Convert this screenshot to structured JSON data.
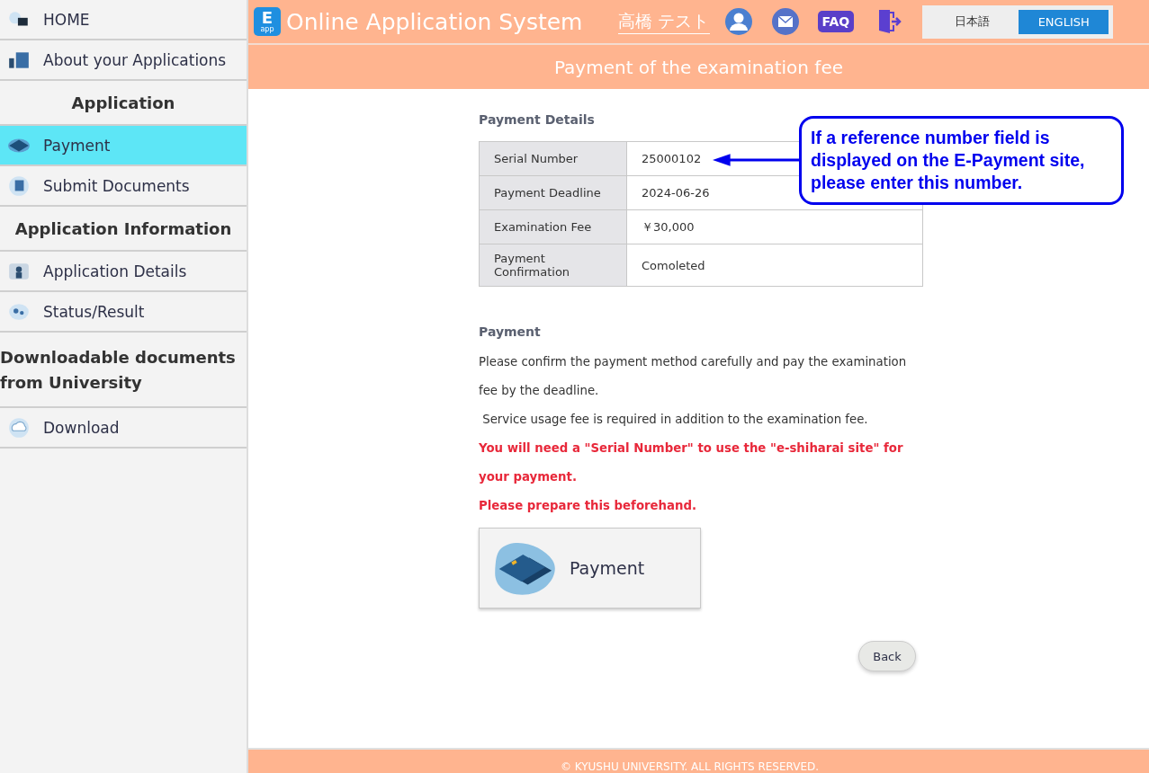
{
  "sidebar": {
    "items": [
      {
        "kind": "link",
        "label": "HOME",
        "selected": false
      },
      {
        "kind": "link",
        "label": "About your Applications",
        "selected": false
      },
      {
        "kind": "heading",
        "label": "Application"
      },
      {
        "kind": "link",
        "label": "Payment",
        "selected": true
      },
      {
        "kind": "link",
        "label": "Submit Documents",
        "selected": false
      },
      {
        "kind": "heading",
        "label": "Application Information"
      },
      {
        "kind": "link",
        "label": "Application Details",
        "selected": false
      },
      {
        "kind": "link",
        "label": "Status/Result",
        "selected": false
      },
      {
        "kind": "section",
        "label": "Downloadable documents from University"
      },
      {
        "kind": "link",
        "label": "Download",
        "selected": false
      }
    ]
  },
  "header": {
    "logo_letter": "E",
    "logo_sub": "app",
    "title": "Online Application System",
    "user_name": "高橋 テスト",
    "faq": "FAQ",
    "languages": [
      {
        "label": "日本語",
        "selected": false
      },
      {
        "label": "ENGLISH",
        "selected": true
      }
    ]
  },
  "page_title": "Payment of the examination fee",
  "details": {
    "heading": "Payment Details",
    "rows": [
      {
        "label": "Serial Number",
        "value": "25000102"
      },
      {
        "label": "Payment Deadline",
        "value": "2024-06-26"
      },
      {
        "label": "Examination Fee",
        "value": "￥30,000"
      },
      {
        "label": "Payment Confirmation",
        "value": "Comoleted"
      }
    ]
  },
  "callout": "If a reference number field is displayed on the E-Payment site, please enter this number.",
  "payment": {
    "heading": "Payment",
    "paragraphs": [
      {
        "kind": "normal",
        "text": "Please confirm the payment method carefully and pay the examination fee by the deadline."
      },
      {
        "kind": "normal",
        "text": " Service usage fee is required in addition to the examination fee."
      },
      {
        "kind": "warning",
        "text": "You will need a \"Serial Number\" to use the \"e-shiharai site\" for your payment."
      },
      {
        "kind": "warning",
        "text": "Please prepare this beforehand."
      }
    ],
    "button": "Payment"
  },
  "back": "Back",
  "footer": "© KYUSHU UNIVERSITY. ALL RIGHTS RESERVED."
}
